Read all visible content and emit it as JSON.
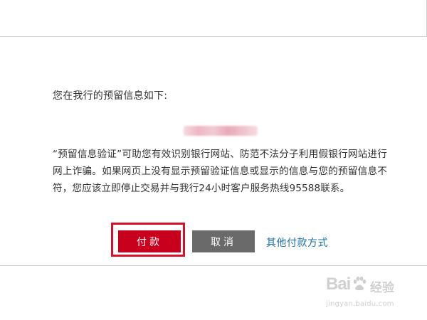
{
  "dialog": {
    "intro_text": "您在我行的预留信息如下:",
    "notice_text": "“预留信息验证”可助您有效识别银行网站、防范不法分子利用假银行网站进行网上诈骗。如果网页上没有显示预留验证信息或显示的信息与您的预留信息不符，您应该立即停止交易并与我行24小时客户服务热线95588联系。",
    "pay_button_label": "付款",
    "cancel_button_label": "取消",
    "other_payment_link": "其他付款方式"
  },
  "watermark": {
    "brand": "Bai",
    "brand_suffix": "经验",
    "url": "jingyan.baidu.com"
  },
  "colors": {
    "pay_button": "#c8001e",
    "cancel_button": "#6a6a6a",
    "link": "#1e6fa8",
    "highlight_border": "#d8102a"
  }
}
